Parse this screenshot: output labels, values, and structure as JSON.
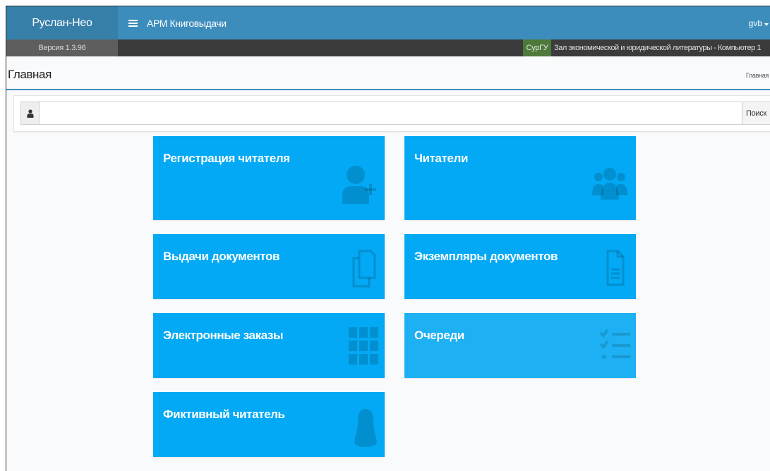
{
  "header": {
    "brand": "Руслан-Нео",
    "app_title": "АРМ Книговыдачи",
    "user": "gvb"
  },
  "subbar": {
    "version": "Версия 1.3.96",
    "organization": "СурГУ",
    "location": "Зал экономической и юридической литературы - Компьютер 1"
  },
  "page": {
    "title": "Главная",
    "breadcrumb": "Главная"
  },
  "search": {
    "value": "",
    "placeholder": "",
    "button_label": "Поиск",
    "addon_icon": "user-icon"
  },
  "tiles": [
    {
      "label": "Регистрация читателя",
      "icon": "user-plus-icon"
    },
    {
      "label": "Читатели",
      "icon": "users-icon"
    },
    {
      "label": "Выдачи документов",
      "icon": "copy-icon"
    },
    {
      "label": "Экземпляры документов",
      "icon": "file-text-icon"
    },
    {
      "label": "Электронные заказы",
      "icon": "grid-icon"
    },
    {
      "label": "Очереди",
      "icon": "checklist-icon"
    },
    {
      "label": "Фиктивный читатель",
      "icon": "incognito-icon"
    }
  ],
  "colors": {
    "navbar": "#3c8dbc",
    "brand": "#367fa9",
    "tile": "#03a9f4",
    "tile_light": "#1db0f2",
    "org_badge": "#4d7a3b"
  }
}
